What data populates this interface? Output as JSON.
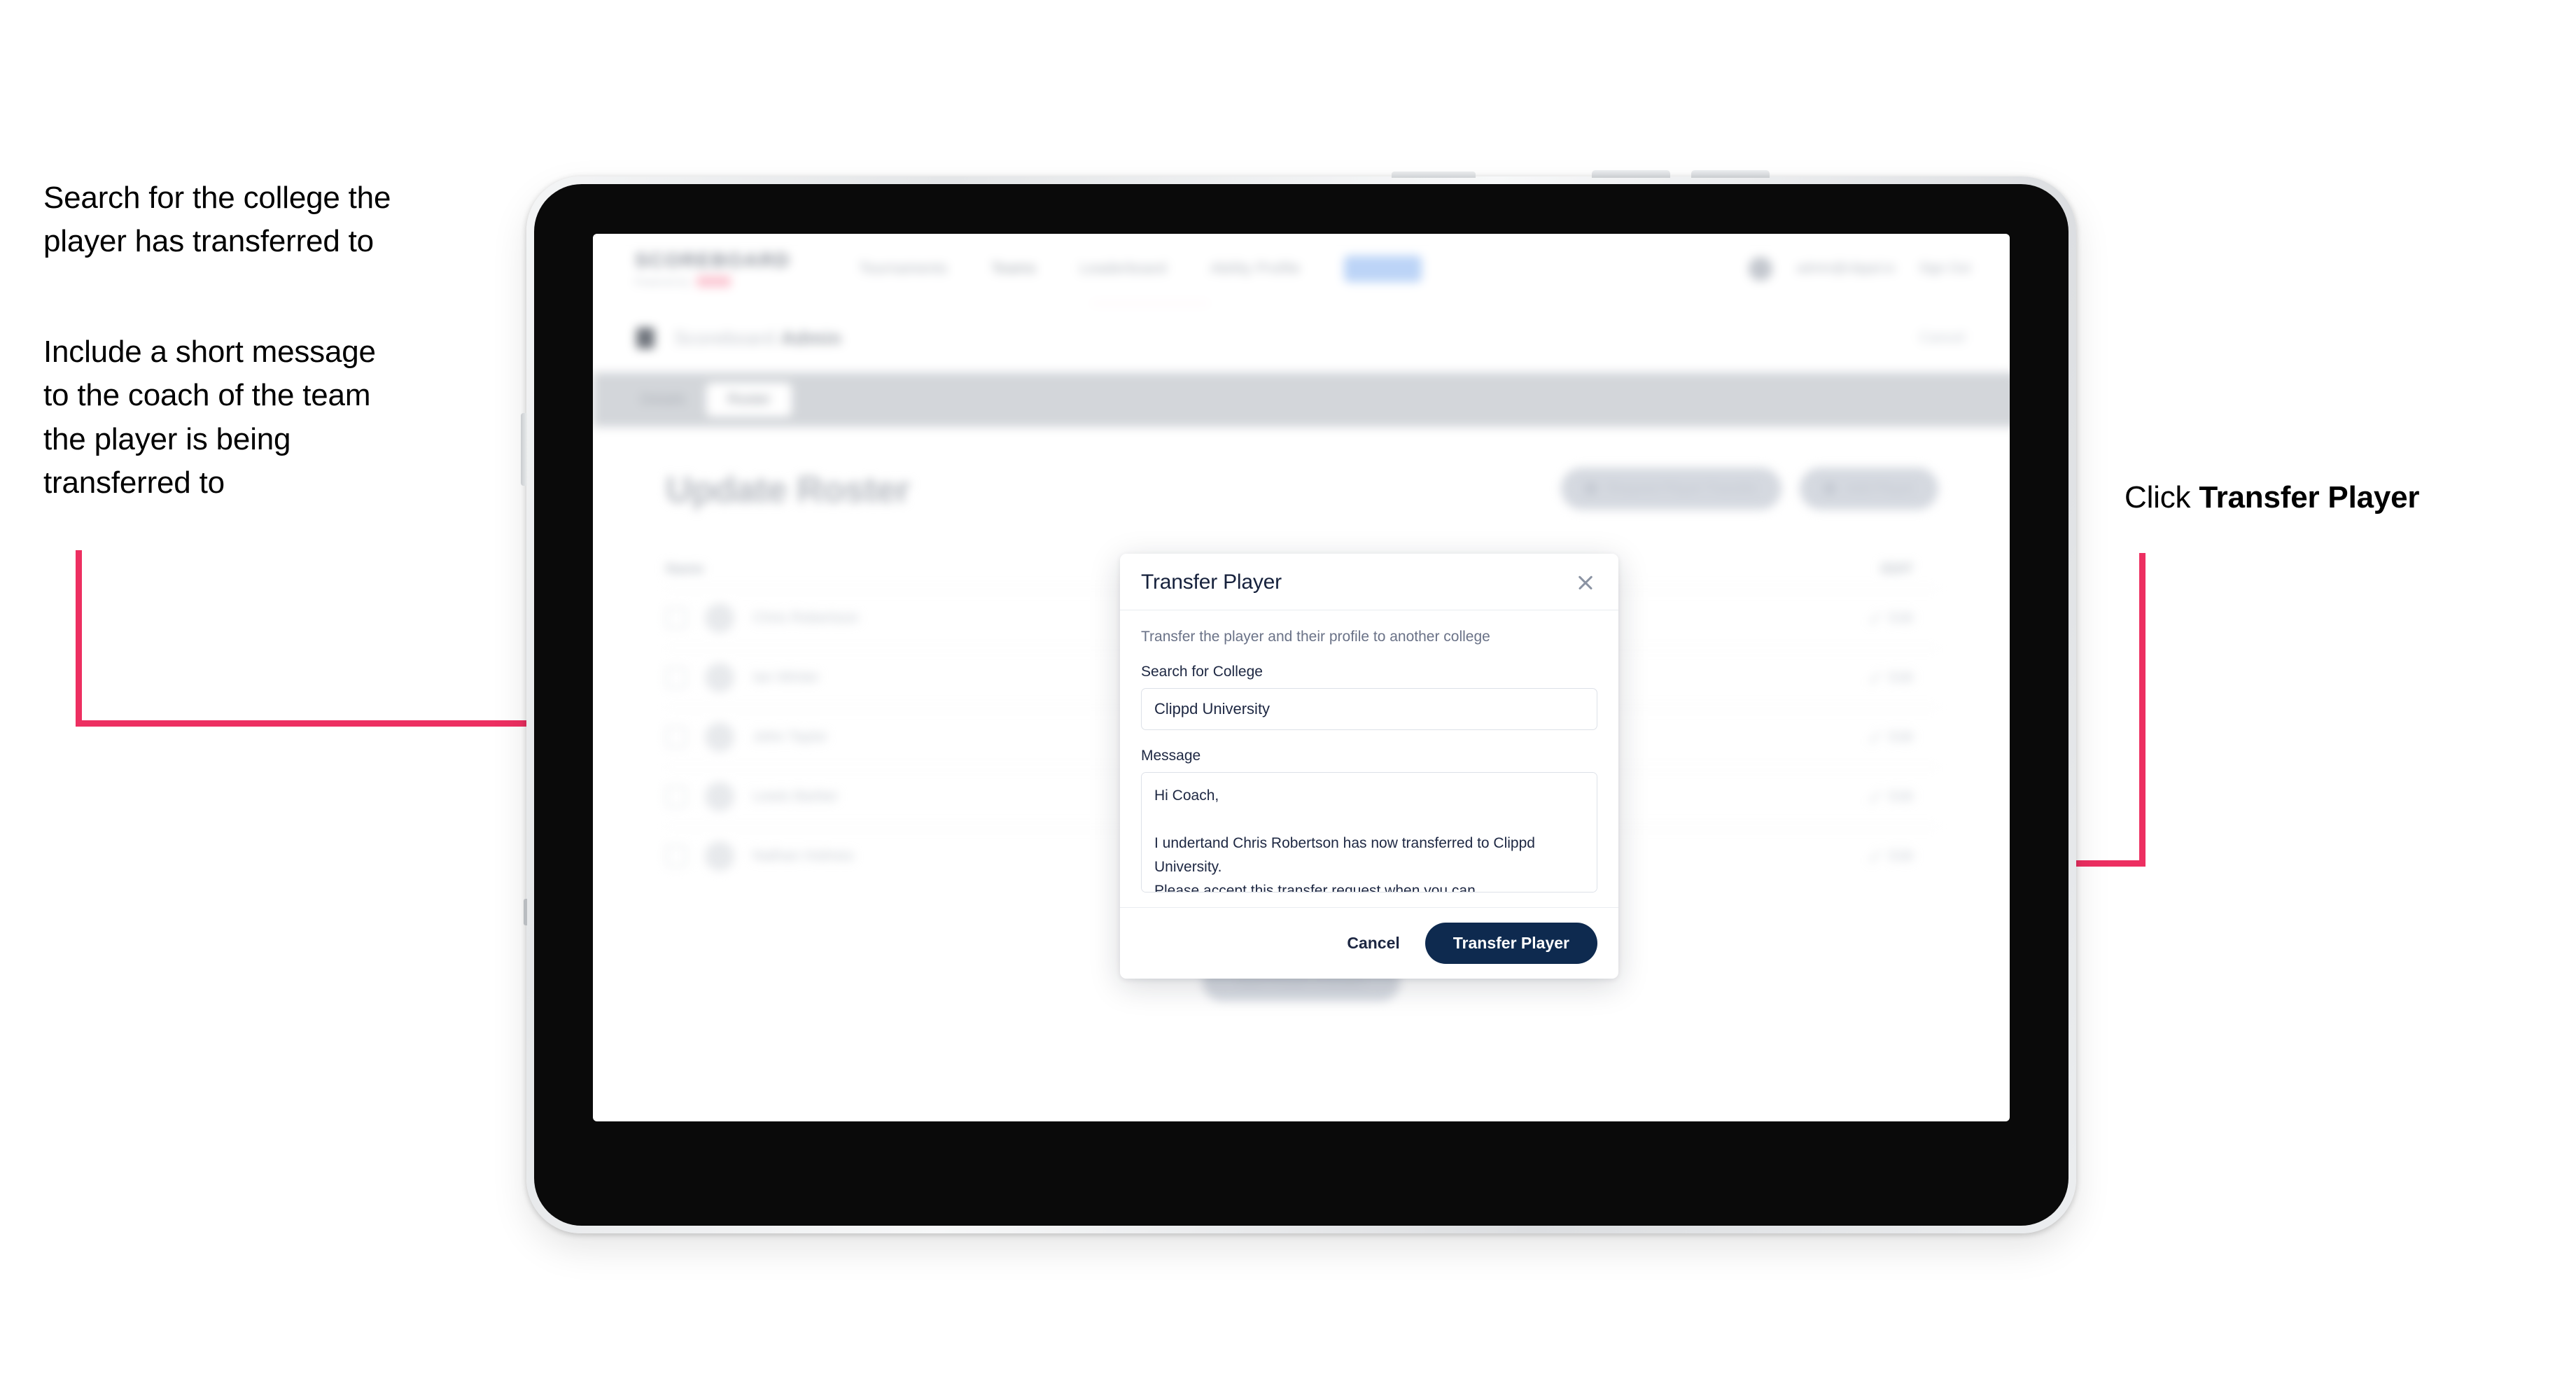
{
  "annotations": {
    "left_1": "Search for the college the\nplayer has transferred to",
    "left_2": "Include a short message\nto the coach of the team\nthe player is being\ntransferred to",
    "right_prefix": "Click ",
    "right_strong": "Transfer Player",
    "connector_color": "#ED2F61"
  },
  "app": {
    "brand": {
      "wordmark": "SCOREBOARD",
      "subtitle": "Powered by",
      "badge": "clippd"
    },
    "nav": [
      {
        "label": "Tournaments"
      },
      {
        "label": "Teams"
      },
      {
        "label": "Leaderboard"
      },
      {
        "label": "Ability Profile"
      },
      {
        "label": "Admin"
      }
    ],
    "topbar_right": {
      "user_email": "admin@clippd.io",
      "sign_out": "Sign Out"
    },
    "breadcrumb": {
      "text": "Scoreboard",
      "suffix": "Admin",
      "right_action": "Cancel"
    },
    "subtabs": [
      {
        "label": "Details",
        "active": false
      },
      {
        "label": "Roster",
        "active": true
      }
    ],
    "page_title": "Update Roster",
    "roster_actions": [
      {
        "label": "Request Player Transfer"
      },
      {
        "label": "Add Player"
      }
    ],
    "roster_columns": {
      "name": "Name",
      "action": "EDIT"
    },
    "roster_rows": [
      {
        "name": "Chris Robertson",
        "edit": "Edit"
      },
      {
        "name": "Ian Winter",
        "edit": "Edit"
      },
      {
        "name": "John Taylor",
        "edit": "Edit"
      },
      {
        "name": "Lewis Barber",
        "edit": "Edit"
      },
      {
        "name": "Nathan Holmes",
        "edit": "Edit"
      }
    ],
    "bottom_action": "Save Roster Changes"
  },
  "modal": {
    "title": "Transfer Player",
    "close_icon": "close-icon",
    "description": "Transfer the player and their profile to another college",
    "college_label": "Search for College",
    "college_value": "Clippd University",
    "college_placeholder": "Search for College",
    "message_label": "Message",
    "message_value": "Hi Coach,\n\nI undertand Chris Robertson has now transferred to Clippd University.\nPlease accept this transfer request when you can.",
    "message_placeholder": "Message",
    "cancel_label": "Cancel",
    "submit_label": "Transfer Player",
    "submit_color": "#0E2A4F"
  }
}
